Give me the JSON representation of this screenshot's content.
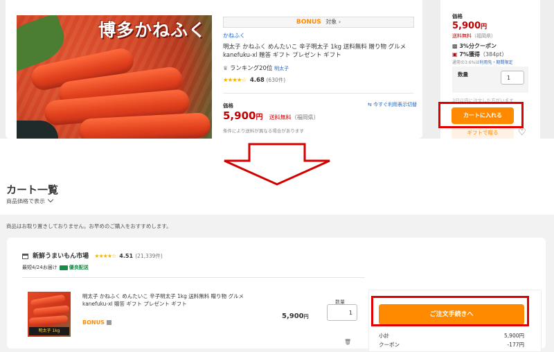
{
  "product": {
    "brand_text": "博多かねふく",
    "bonus": "BONUS",
    "bonus_target": "対象 ›",
    "shop": "かねふく",
    "title": "明太子 かねふく めんたいこ 辛子明太子 1kg 送料無料 贈り物 グルメ kanefuku-xl 贈答 ギフト プレゼント ギフト",
    "ranking": "ランキング20位",
    "ranking_category": "明太子",
    "stars": "★★★★☆",
    "rating": "4.68",
    "review_count": "(630件)",
    "price_label": "価格",
    "now_usable": "今すぐ利用表示切替",
    "price": "5,900",
    "yen": "円",
    "shipping": "送料無料",
    "area": "（福岡県）",
    "condition_note": "条件により送料が異なる場合があります"
  },
  "side": {
    "price_label": "価格",
    "price": "5,900",
    "yen": "円",
    "shipping": "送料無料",
    "area": "（福岡県）",
    "coupon": "3%分クーポン",
    "points": "7%獲得",
    "points_value": "（384pt）",
    "points_note": "通常の3:6%は",
    "points_link": "利用先・期間限定",
    "qty_label": "数量",
    "qty_value": "1",
    "note": "3日以内に注文した方がいます",
    "cart_button": "カートに入れる",
    "gift_button": "ギフトで贈る"
  },
  "cart": {
    "title": "カート一覧",
    "price_display": "商品価格で表示",
    "notice": "商品はお取り置きしておりません。お早めのご購入をおすすめします。",
    "shop_name": "新鮮うまいもん市場",
    "shop_stars": "★★★★☆",
    "shop_rating": "4.51",
    "shop_reviews": "(21,339件)",
    "delivery": "最短4/24お届け",
    "delivery_priority": "優良配送",
    "item_title": "明太子 かねふく めんたいこ 辛子明太子 1kg 送料無料 贈り物 グルメ kanefuku-xl 贈答 ギフト プレゼント ギフト",
    "item_bonus": "BONUS",
    "item_image_label": "明太子 1kg",
    "item_price": "5,900",
    "item_yen": "円",
    "qty_label": "数量",
    "qty_value": "1",
    "checkout_button": "ご注文手続きへ",
    "subtotal_label": "小計",
    "subtotal_value": "5,900円",
    "coupon_label": "クーポン",
    "coupon_value": "-177円"
  },
  "colors": {
    "accent_orange": "#ff8a00",
    "price_red": "#bf0000",
    "highlight_red": "#e00000",
    "link_blue": "#1a66d2"
  }
}
